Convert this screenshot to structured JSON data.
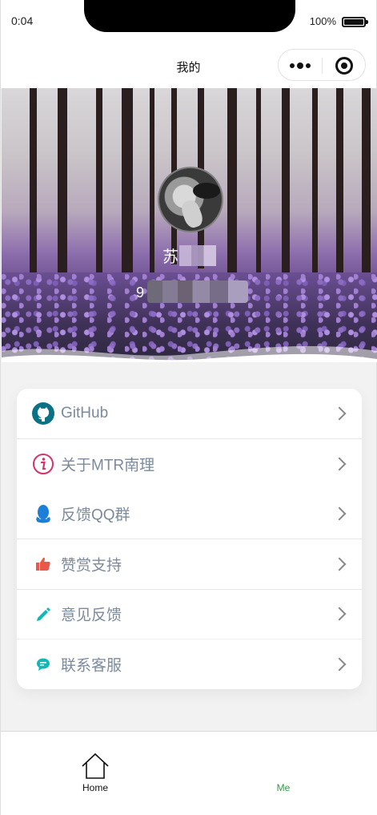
{
  "status": {
    "time": "0:04",
    "battery": "100%"
  },
  "nav": {
    "title": "我的"
  },
  "profile": {
    "name_visible": "苏",
    "id_visible": "9"
  },
  "menu": [
    {
      "label": "GitHub",
      "icon": "github-icon",
      "color": "#0b7285"
    },
    {
      "label": "关于MTR南理",
      "icon": "info-icon",
      "color": "#d6336c"
    },
    {
      "label": "反馈QQ群",
      "icon": "qq-icon",
      "color": "#1c7ed6"
    },
    {
      "label": "赞赏支持",
      "icon": "thumbs-up-icon",
      "color": "#e8594c"
    },
    {
      "label": "意见反馈",
      "icon": "pencil-icon",
      "color": "#12b8b8"
    },
    {
      "label": "联系客服",
      "icon": "chat-icon",
      "color": "#12b8b8"
    }
  ],
  "tabs": [
    {
      "label": "Home",
      "color": "#111111"
    },
    {
      "label": "Me",
      "color": "#2f9e44"
    }
  ]
}
